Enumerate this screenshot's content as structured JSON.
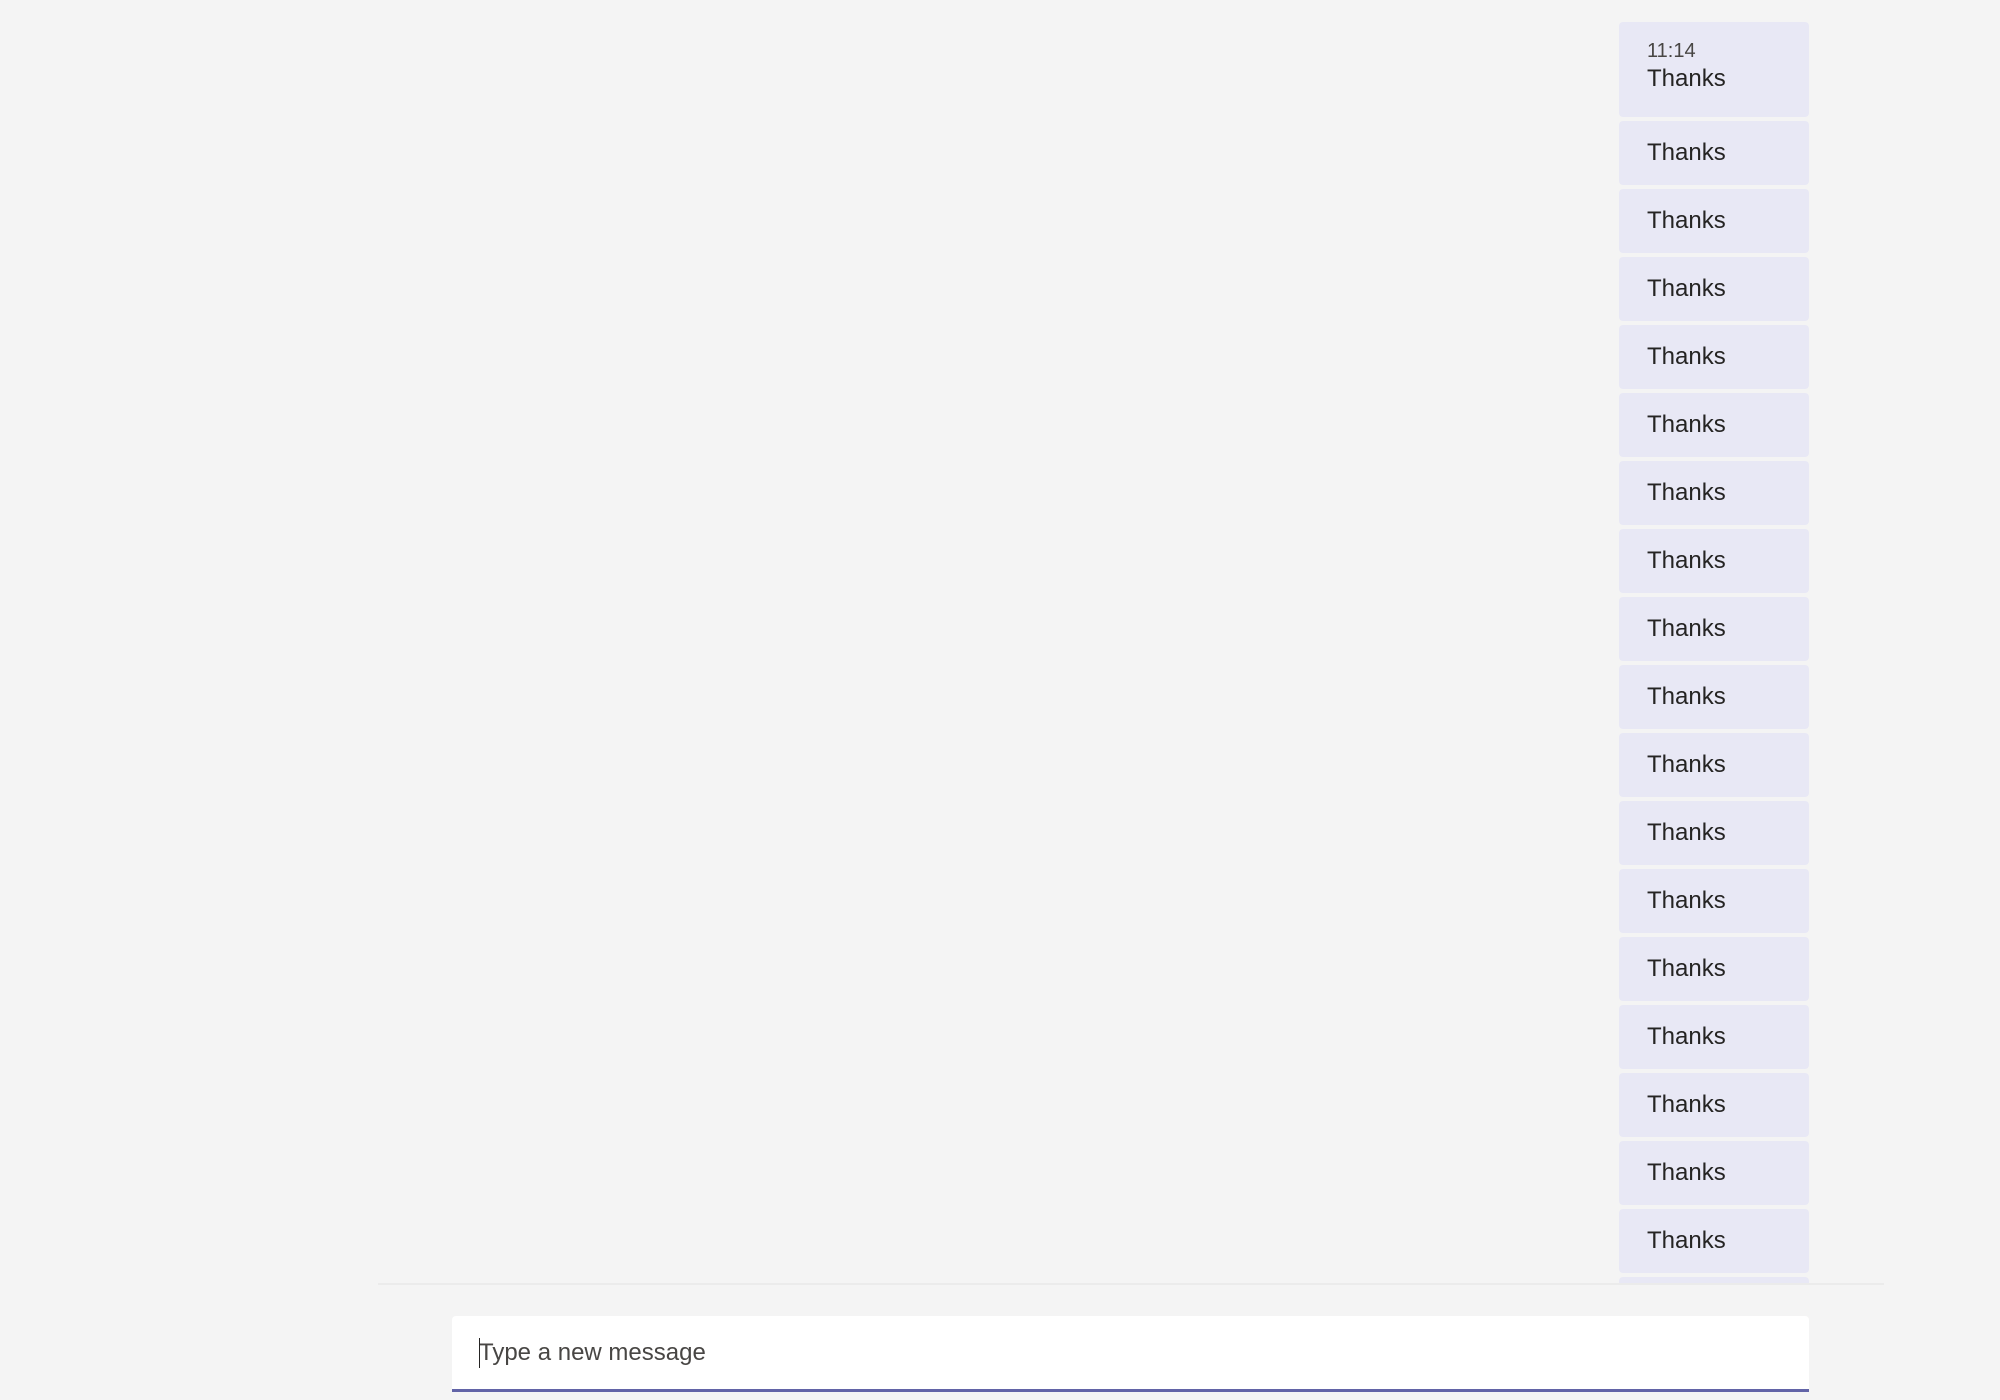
{
  "chat": {
    "messages": [
      {
        "time": "11:14",
        "text": "Thanks"
      },
      {
        "text": "Thanks"
      },
      {
        "text": "Thanks"
      },
      {
        "text": "Thanks"
      },
      {
        "text": "Thanks"
      },
      {
        "text": "Thanks"
      },
      {
        "text": "Thanks"
      },
      {
        "text": "Thanks"
      },
      {
        "text": "Thanks"
      },
      {
        "text": "Thanks"
      },
      {
        "text": "Thanks"
      },
      {
        "text": "Thanks"
      },
      {
        "text": "Thanks"
      },
      {
        "text": "Thanks"
      },
      {
        "text": "Thanks"
      },
      {
        "text": "Thanks"
      },
      {
        "text": "Thanks"
      },
      {
        "text": "Thanks"
      }
    ]
  },
  "compose": {
    "placeholder": "Type a new message",
    "value": ""
  },
  "colors": {
    "background": "#f4f4f4",
    "bubble": "#e8e8f5",
    "accent": "#6264a7"
  }
}
